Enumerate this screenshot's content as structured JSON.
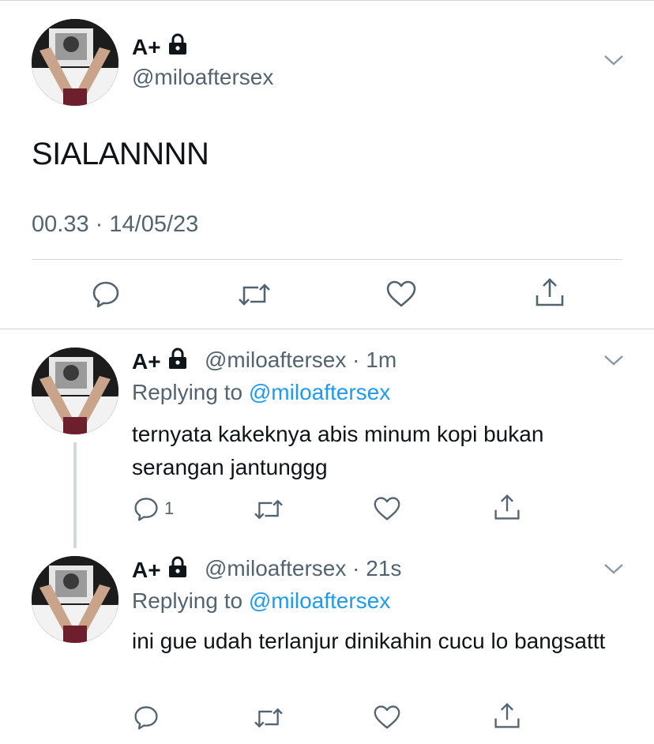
{
  "main_tweet": {
    "display_name": "A+",
    "handle": "@miloaftersex",
    "text": "SIALANNNN",
    "time": "00.33",
    "separator": "·",
    "date": "14/05/23",
    "actions": [
      {
        "icon": "reply-icon"
      },
      {
        "icon": "retweet-icon"
      },
      {
        "icon": "like-icon"
      },
      {
        "icon": "share-icon"
      }
    ]
  },
  "replies": [
    {
      "display_name": "A+",
      "handle": "@miloaftersex",
      "time": "· 1m",
      "replying_prefix": "Replying to",
      "replying_to": "@miloaftersex",
      "text": "ternyata kakeknya abis minum kopi bukan serangan jantunggg",
      "reply_count": "1"
    },
    {
      "display_name": "A+",
      "handle": "@miloaftersex",
      "time": "· 21s",
      "replying_prefix": "Replying to",
      "replying_to": "@miloaftersex",
      "text": "ini gue udah terlanjur dinikahin cucu lo bangsattt",
      "reply_count": ""
    }
  ],
  "colors": {
    "text": "#0f1419",
    "secondary": "#536471",
    "link": "#1d9bf0",
    "divider": "#d0d4d8"
  }
}
